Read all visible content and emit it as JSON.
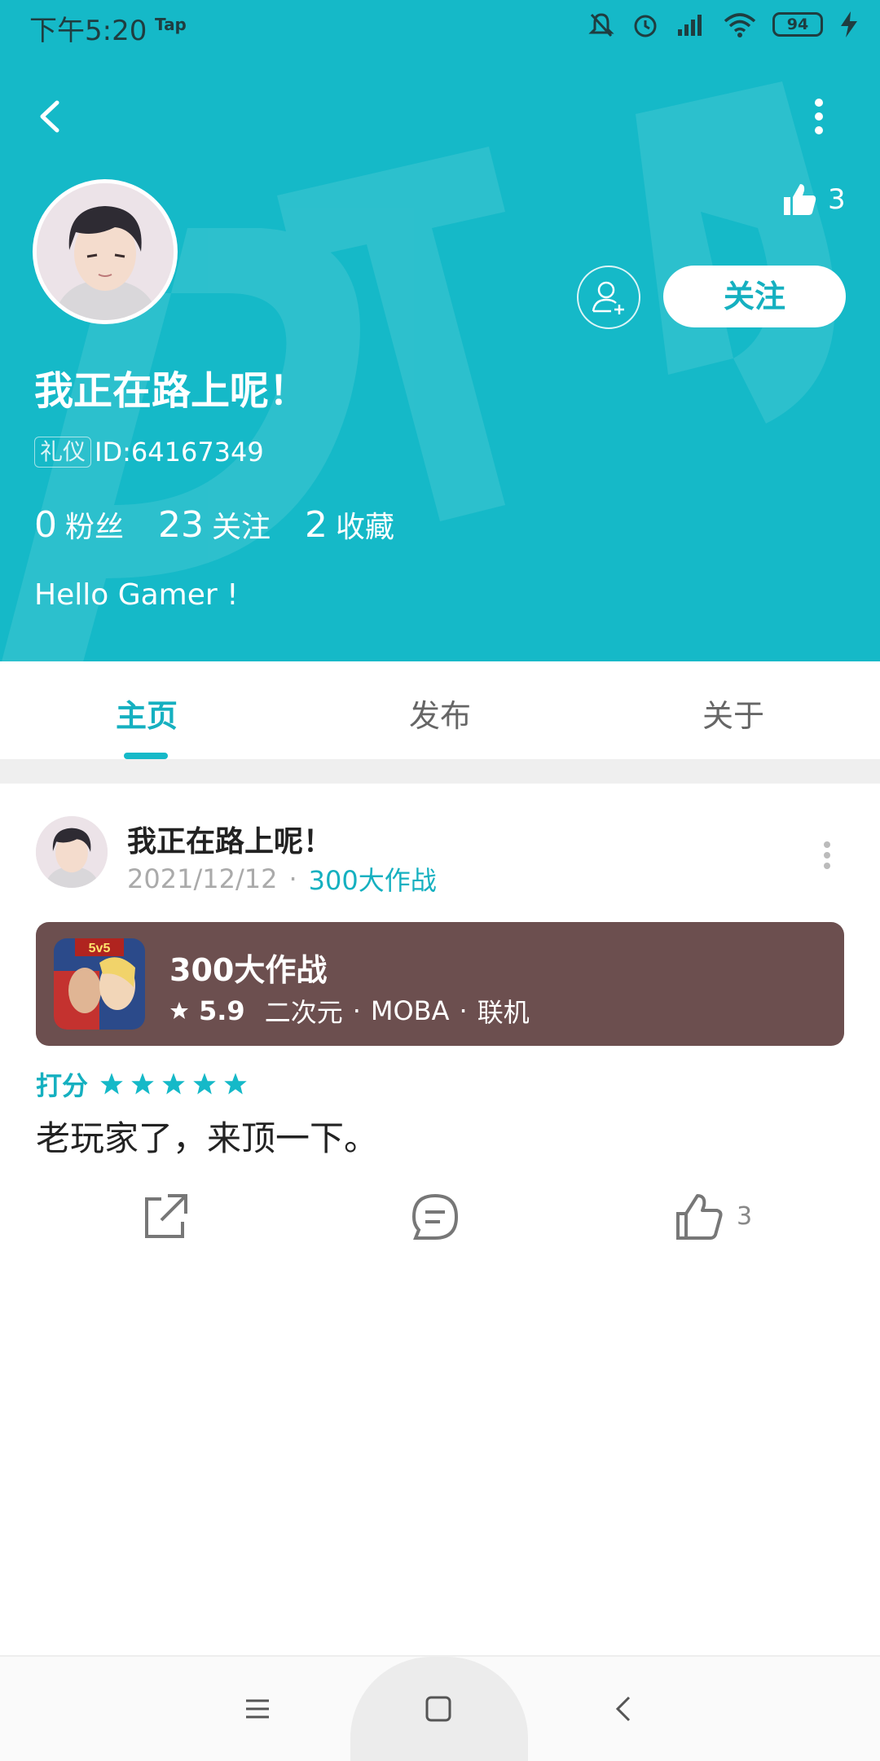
{
  "status_bar": {
    "time": "下午5:20",
    "app_tag": "Tap",
    "battery": "94"
  },
  "profile": {
    "like_count": "3",
    "follow_label": "关注",
    "nickname": "我正在路上呢！",
    "badge": "礼仪",
    "id_text": "ID:64167349",
    "stats": [
      {
        "num": "0",
        "label": "粉丝"
      },
      {
        "num": "23",
        "label": "关注"
      },
      {
        "num": "2",
        "label": "收藏"
      }
    ],
    "bio": "Hello Gamer !"
  },
  "tabs": [
    {
      "label": "主页",
      "active": true
    },
    {
      "label": "发布",
      "active": false
    },
    {
      "label": "关于",
      "active": false
    }
  ],
  "post": {
    "author": "我正在路上呢！",
    "date": "2021/12/12",
    "separator": "·",
    "game_link": "300大作战",
    "game_card": {
      "name": "300大作战",
      "rating": "5.9",
      "tags": [
        "二次元",
        "MOBA",
        "联机"
      ],
      "icon_label": "5v5"
    },
    "score_label": "打分",
    "stars": 5,
    "review": "老玩家了，来顶一下。",
    "like_count": "3"
  },
  "colors": {
    "brand": "#15b9c8",
    "card": "#6c4f4f"
  }
}
